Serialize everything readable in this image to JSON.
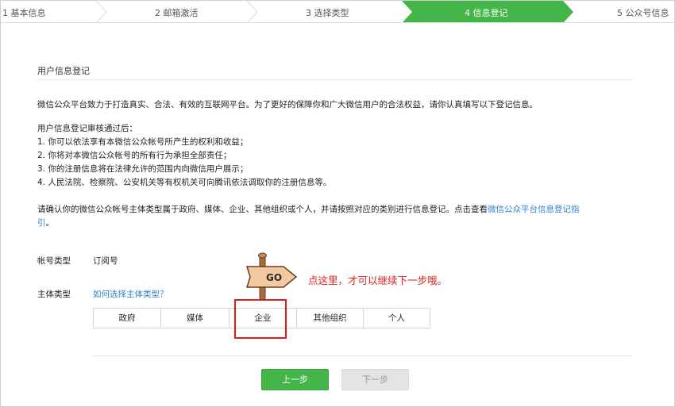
{
  "steps": [
    {
      "label": "1 基本信息",
      "active": false
    },
    {
      "label": "2 邮箱激活",
      "active": false
    },
    {
      "label": "3 选择类型",
      "active": false
    },
    {
      "label": "4 信息登记",
      "active": true
    },
    {
      "label": "5 公众号信息",
      "active": false
    }
  ],
  "colors": {
    "active_step": "#44b549",
    "link": "#2f7fd0",
    "annotation": "#e02020",
    "primary_button": "#44b549"
  },
  "section_title": "用户信息登记",
  "intro": "微信公众平台致力于打造真实、合法、有效的互联网平台。为了更好的保障你和广大微信用户的合法权益，请你认真填写以下登记信息。",
  "review_heading": "用户信息登记审核通过后：",
  "review_items": [
    "1. 你可以依法享有本微信公众帐号所产生的权利和收益；",
    "2. 你将对本微信公众帐号的所有行为承担全部责任；",
    "3. 你的注册信息将在法律允许的范围内向微信用户展示；",
    "4. 人民法院、检察院、公安机关等有权机关可向腾讯依法调取你的注册信息等。"
  ],
  "notice_text": "请确认你的微信公众帐号主体类型属于政府、媒体、企业、其他组织或个人，并请按照对应的类别进行信息登记。点击查看",
  "notice_link_part1": "微信公众平台信息登记指",
  "notice_link_part2": "引",
  "notice_end": "。",
  "account_type_label": "帐号类型",
  "account_type_value": "订阅号",
  "subject_type_label": "主体类型",
  "subject_type_help": "如何选择主体类型？",
  "subject_types": [
    "政府",
    "媒体",
    "企业",
    "其他组织",
    "个人"
  ],
  "sign_text": "GO",
  "annotation": "点这里，才可以继续下一步哦。",
  "prev_button": "上一步",
  "next_button": "下一步"
}
